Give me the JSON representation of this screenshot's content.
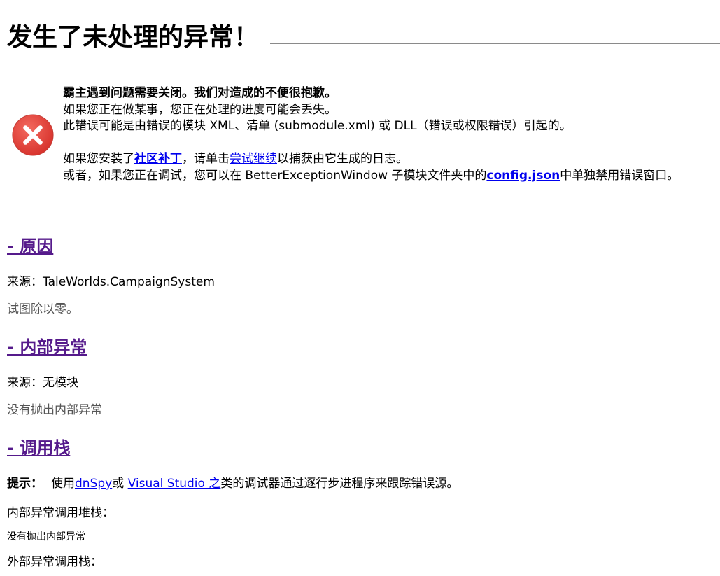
{
  "header": {
    "title": "发生了未处理的异常！"
  },
  "intro": {
    "line1": "霸主遇到问题需要关闭。我们对造成的不便很抱歉。",
    "line2": "如果您正在做某事，您正在处理的进度可能会丢失。",
    "line3": "此错误可能是由错误的模块 XML、清单 (submodule.xml) 或 DLL（错误或权限错误）引起的。",
    "line4_prefix": "如果您安装了",
    "line4_link_community_patch": "社区补丁",
    "line4_mid": "，请单击",
    "line4_link_try_continue": "尝试继续",
    "line4_suffix": "以捕获由它生成的日志。",
    "line5_prefix": "或者，如果您正在调试，您可以在 BetterExceptionWindow 子模块文件夹中的",
    "line5_link_config": "config.json",
    "line5_suffix": "中单独禁用错误窗口。"
  },
  "sections": {
    "cause": {
      "heading": "- 原因",
      "source": "来源：TaleWorlds.CampaignSystem",
      "message": "试图除以零。"
    },
    "inner": {
      "heading": "- 内部异常",
      "source": "来源：无模块",
      "message": "没有抛出内部异常"
    },
    "stack": {
      "heading": "- 调用栈",
      "hint_label": "提示：",
      "hint_prefix": "使用",
      "hint_link_dnspy": "dnSpy",
      "hint_or": "或 ",
      "hint_link_vs": "Visual Studio 之",
      "hint_suffix": "类的调试器通过逐行步进程序来跟踪错误源。",
      "inner_stack_label": "内部异常调用堆栈：",
      "inner_stack_value": "没有抛出内部异常",
      "outer_stack_label": "外部异常调用栈："
    }
  },
  "icons": {
    "error": "error-x-circle-icon"
  },
  "colors": {
    "error_red": "#e03c3c",
    "link_blue": "#0000ee",
    "visited_purple": "#551a8b"
  }
}
